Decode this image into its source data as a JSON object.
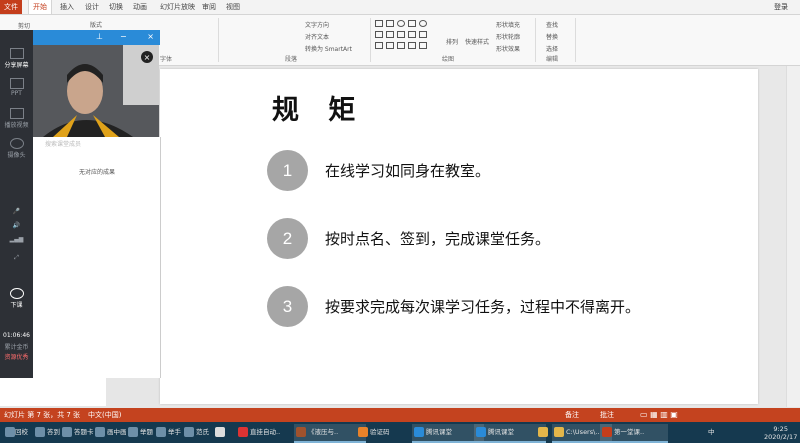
{
  "ribbon_tabs": [
    "文件",
    "开始",
    "插入",
    "设计",
    "切换",
    "动画",
    "幻灯片放映",
    "审阅",
    "视图"
  ],
  "login_label": "登录",
  "ribbon": {
    "clipboard": {
      "cut": "剪切",
      "label": "剪贴板"
    },
    "layout": "版式",
    "font_group": "字体",
    "paragraph": {
      "text_direction": "文字方向",
      "align_text": "对齐文本",
      "smartart": "转换为 SmartArt",
      "label": "段落"
    },
    "drawing": {
      "arrange": "排列",
      "quick_styles": "快速样式",
      "fill": "形状填充",
      "outline": "形状轮廓",
      "effects": "形状效果",
      "label": "绘图"
    },
    "editing": {
      "find": "查找",
      "replace": "替换",
      "select": "选择",
      "label": "编辑"
    }
  },
  "live_panel": {
    "share_screen": "分享屏幕",
    "ppt": "PPT",
    "play_video": "播放视频",
    "camera": "摄像头",
    "exit": "下课",
    "timer": "01:06:46",
    "network_label": "累计金币",
    "quality": "资源优秀",
    "video_caption": "摄像头画面",
    "empty_results": "无对应的成果",
    "search_hint": "搜索课堂成员"
  },
  "slide": {
    "title": "规 矩",
    "rules": [
      {
        "num": "1",
        "text": "在线学习如同身在教室。"
      },
      {
        "num": "2",
        "text": "按时点名、签到，完成课堂任务。"
      },
      {
        "num": "3",
        "text": "按要求完成每次课学习任务，过程中不得离开。"
      }
    ]
  },
  "status": {
    "slide_info": "幻灯片 第 7 张，共 7 张",
    "language": "中文(中国)",
    "notes": "备注",
    "comments": "批注"
  },
  "taskbar": {
    "items": [
      "回校",
      "答到",
      "答题卡",
      "画中画",
      "举题",
      "举手",
      "范氏",
      "",
      "直挂自动..",
      "",
      "《液压与..",
      "验证码",
      "腾讯课堂",
      "腾讯课堂",
      "",
      "C:\\Users\\..",
      "",
      "第一堂课.."
    ],
    "time": "9:25",
    "date": "2020/2/17",
    "ime": "中"
  },
  "colors": {
    "accent": "#c43e1c",
    "taskbar": "#15394f",
    "circle": "#a6a6a6",
    "panel": "#2d3036"
  }
}
